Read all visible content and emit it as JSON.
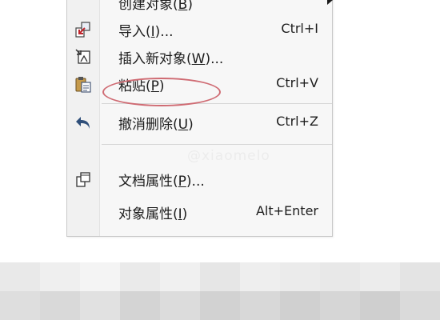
{
  "menu": {
    "items": [
      {
        "id": "create",
        "label": "创建对象(",
        "mnemonic": "B",
        "suffix": ")",
        "shortcut": "",
        "icon": "none",
        "submenu": true
      },
      {
        "id": "import",
        "label": "导入(",
        "mnemonic": "I",
        "suffix": ")...",
        "shortcut": "Ctrl+I",
        "icon": "import-icon"
      },
      {
        "id": "insert-object",
        "label": "插入新对象(",
        "mnemonic": "W",
        "suffix": ")...",
        "shortcut": "",
        "icon": "insert-object-icon"
      },
      {
        "id": "paste",
        "label": "粘贴(",
        "mnemonic": "P",
        "suffix": ")",
        "shortcut": "Ctrl+V",
        "icon": "paste-icon"
      },
      {
        "id": "undo-delete",
        "label": "撤消删除(",
        "mnemonic": "U",
        "suffix": ")",
        "shortcut": "Ctrl+Z",
        "icon": "undo-icon"
      },
      {
        "id": "doc-props",
        "label": "文档属性(",
        "mnemonic": "P",
        "suffix": ")...",
        "shortcut": "",
        "icon": "document-properties-icon"
      },
      {
        "id": "obj-props",
        "label": "对象属性(",
        "mnemonic": "I",
        "suffix": ")",
        "shortcut": "Alt+Enter",
        "icon": "none"
      }
    ]
  },
  "annotation": {
    "color": "#cf6b73",
    "target": "paste"
  },
  "watermark": "@xiaomelo",
  "mosaic": {
    "colors": [
      "#e9e9e9",
      "#efefef",
      "#f4f4f4",
      "#eaeaea",
      "#f0f0f0",
      "#e6e6e6",
      "#eeeeee",
      "#ebebeb",
      "#e8e8e8",
      "#ececec",
      "#e4e4e4",
      "#dedede",
      "#d9d9d9",
      "#e1e1e1",
      "#d4d4d4",
      "#dcdcdc",
      "#d2d2d2",
      "#d8d8d8",
      "#d0d0d0",
      "#d6d6d6",
      "#cfcfcf",
      "#dadada"
    ]
  }
}
